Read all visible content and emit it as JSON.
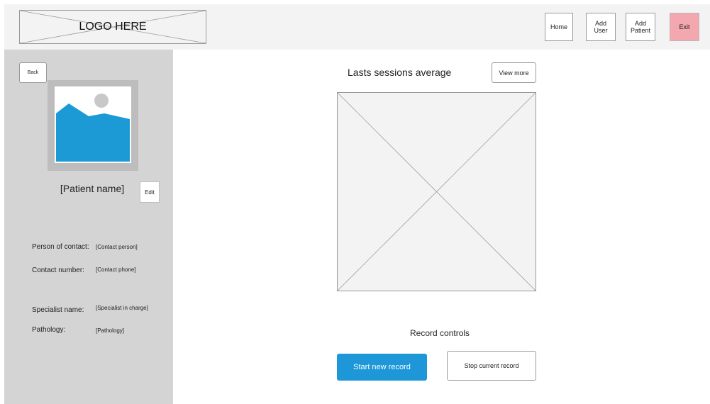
{
  "header": {
    "logo_text": "LOGO HERE",
    "nav": {
      "home": "Home",
      "add_user": "Add\nUser",
      "add_patient": "Add\nPatient",
      "exit": "Exit"
    }
  },
  "sidebar": {
    "back_label": "Back",
    "patient_name": "[Patient name]",
    "edit_label": "Edit",
    "fields": {
      "contact_person": {
        "label": "Person of contact:",
        "value": "[Contact person]"
      },
      "contact_number": {
        "label": "Contact number:",
        "value": "[Contact phone]"
      },
      "specialist": {
        "label": "Specialist name:",
        "value": "[Specialist in charge]"
      },
      "pathology": {
        "label": "Pathology:",
        "value": "[Pathology]"
      }
    }
  },
  "main": {
    "chart_title": "Lasts sessions average",
    "view_more_label": "View more",
    "record_controls_title": "Record controls",
    "start_label": "Start new record",
    "stop_label": "Stop current record"
  },
  "colors": {
    "topbar_bg": "#f3f3f3",
    "sidebar_bg": "#d4d4d4",
    "exit_bg": "#f3a7ae",
    "primary": "#1d97d8",
    "image_blue": "#1b9ad6"
  }
}
